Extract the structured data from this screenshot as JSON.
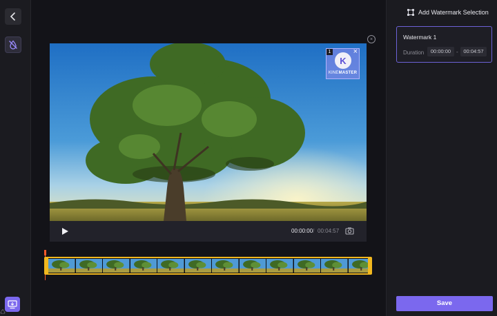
{
  "sidebar": {
    "back_icon": "chevron-left-icon",
    "watermark_tool_icon": "watermark-erase-icon",
    "export_icon": "export-monitor-icon",
    "corner_glyph": "♺"
  },
  "preview": {
    "close_glyph": "×",
    "watermark_overlay": {
      "index": "1",
      "close_glyph": "×",
      "logo_letter": "K",
      "logo_text_part1": "KINE",
      "logo_text_part2": "MASTER"
    },
    "controls": {
      "current_time": "00:00:00",
      "separator": "/",
      "total_time": "00:04:57"
    }
  },
  "timeline": {
    "frame_count": 12,
    "accent_color": "#f2b81f",
    "playhead_color": "#ff5a2a"
  },
  "panel": {
    "add_selection_label": "Add Watermark Selection",
    "watermarks": [
      {
        "title": "Watermark 1",
        "duration_label": "Duration",
        "start": "00:00:00",
        "dash": "-",
        "end": "00:04:57"
      }
    ],
    "save_label": "Save"
  },
  "colors": {
    "accent": "#7b68ee",
    "background": "#131318",
    "panel": "#1b1b20"
  }
}
